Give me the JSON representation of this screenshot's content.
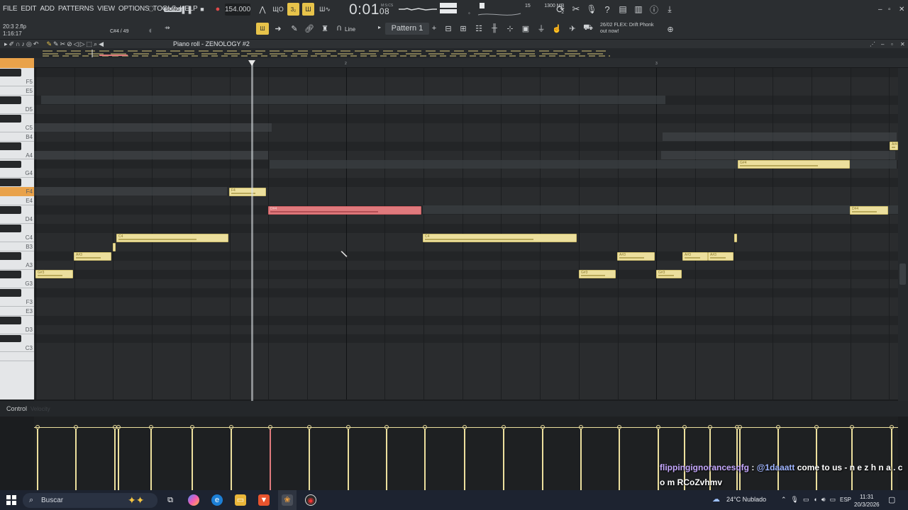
{
  "menu": [
    "FILE",
    "EDIT",
    "ADD",
    "PATTERNS",
    "VIEW",
    "OPTIONS",
    "TOOLS",
    "HELP"
  ],
  "transport": {
    "song_mode": "SONG",
    "tempo": "154.000",
    "time_main": "0:01",
    "time_sub": "08",
    "time_unit": "M:S:CS"
  },
  "toolbar": {
    "pattern": "Pattern 1",
    "snap": "Line",
    "cpu": "15",
    "ram": "1300 MB",
    "voices": "2"
  },
  "hint": {
    "line1": "20:3 2.flp",
    "line2": "1:16:17",
    "note_info": "C#4 / 49"
  },
  "news": {
    "date": "26/02",
    "text": "FLEX: Drift Phonk",
    "text2": "out now!"
  },
  "piano_roll": {
    "title": "Piano roll - ZENOLOGY #2",
    "bar2": "2",
    "bar3": "3"
  },
  "keys": [
    "F5",
    "E5",
    "D5",
    "C5",
    "B4",
    "A4",
    "G4",
    "F4",
    "E4",
    "D4",
    "C4",
    "B3",
    "A3",
    "G3",
    "F3",
    "E3",
    "D3",
    "C3"
  ],
  "notes": [
    {
      "pitch": "G#3",
      "label": "G#3"
    },
    {
      "pitch": "A#3",
      "label": "A#3"
    },
    {
      "pitch": "C4",
      "label": "C4"
    },
    {
      "pitch": "F4",
      "label": "F4"
    },
    {
      "pitch": "D#4",
      "label": "D#4"
    },
    {
      "pitch": "C4",
      "label": "C4"
    },
    {
      "pitch": "G#3",
      "label": "G#3"
    },
    {
      "pitch": "A#3",
      "label": "A#3"
    },
    {
      "pitch": "G#3",
      "label": "G#3"
    },
    {
      "pitch": "A#3",
      "label": "A#3"
    },
    {
      "pitch": "A#3",
      "label": "A#3"
    },
    {
      "pitch": "G#4",
      "label": "G#4"
    },
    {
      "pitch": "D#4",
      "label": "D#4"
    },
    {
      "pitch": "A#4",
      "label": "A#4"
    }
  ],
  "control": {
    "label": "Control",
    "param": "Velocity"
  },
  "chat": {
    "user": "flippingignorancesqfg",
    "sep": ":",
    "mention": "@1daaatt",
    "message": "come to us - n e z h n a . c o m RCoZvhmv"
  },
  "taskbar": {
    "search": "Buscar",
    "weather": "24°C  Nublado",
    "lang": "ESP",
    "time": "11:31",
    "date": "20/3/2026"
  }
}
